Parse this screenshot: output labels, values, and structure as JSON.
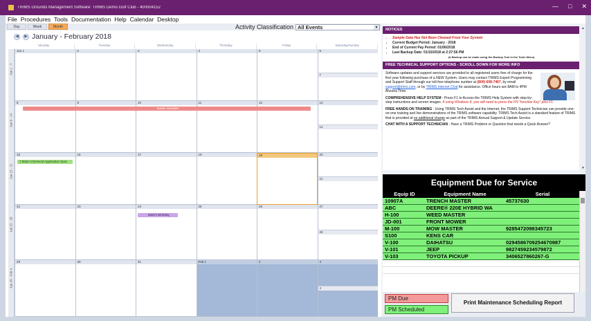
{
  "window": {
    "title": "TRIMS Grounds Management Software: TRIMS Demo Golf Club - 400004152",
    "controls": [
      "—",
      "□",
      "✕"
    ]
  },
  "menu": [
    "File",
    "Procedures",
    "Tools",
    "Documentation",
    "Help",
    "Calendar",
    "Desktop"
  ],
  "view_tabs": [
    "Day",
    "Week",
    "Month"
  ],
  "activity": {
    "label": "Activity Classification",
    "value": "All Events"
  },
  "calendar": {
    "title": "January - February 2018",
    "weekdays": [
      "Monday",
      "Tuesday",
      "Wednesday",
      "Thursday",
      "Friday",
      "Saturday/Sunday"
    ],
    "weeks": [
      {
        "label": "Jan 1 - 7",
        "days": [
          "Jan 1",
          "2",
          "3",
          "4",
          "5",
          "6"
        ],
        "sun": "7"
      },
      {
        "label": "Jan 8 - 14",
        "days": [
          "8",
          "9",
          "10",
          "11",
          "12",
          "13"
        ],
        "sun": "14"
      },
      {
        "label": "Jan 15 - 21",
        "days": [
          "15",
          "16",
          "17",
          "18",
          "19",
          "20"
        ],
        "sun": "21"
      },
      {
        "label": "Jan 22 - 28",
        "days": [
          "22",
          "23",
          "24",
          "25",
          "26",
          "27"
        ],
        "sun": "28"
      },
      {
        "label": "Jan 29 - Feb 4",
        "days": [
          "29",
          "30",
          "31",
          "Feb 1",
          "2",
          "3"
        ],
        "sun": "4"
      }
    ],
    "events": {
      "vacation": "Susan Vacation",
      "chemical": "7:00am Chemical Application Spra",
      "birthday": "Mark's Birthday"
    }
  },
  "notices": {
    "header": "NOTICES",
    "items": [
      "Sample Data Has Not Been Cleaned From Your System",
      "Current Budget Period: January - 2018",
      "End of Current Pay Period: 01/06/2018",
      "Last Backup Date: 01/15/2018 at 2:27:56 PM"
    ],
    "backup_note": "(A Backup can be made using the Backup Tool in the Tools Menu)",
    "support_header": "FREE TECHNICAL SUPPORT OPTIONS - SCROLL DOWN FOR MORE INFO",
    "support_text_1": "Software updates and support services are provided to all registered users free of charge for the first year following purchase of a NEW System. Users may contact TRIMS Expert Programming and Support Staff through our toll-free telephone number at",
    "phone": "(800) 608-7467",
    "support_text_2": ", by email",
    "email": "support@trims.com",
    "support_text_3": ", or by",
    "chat_link": "TRIMS Internet Chat",
    "support_text_4": "for assistance. Office hours are 8AM to 4PM Arizona Time.",
    "help_title": "COMPREHENSIVE HELP SYSTEM",
    "help_text": " - Press F1 to Access the TRIMS Help System with step-by-step instructions and screen images.",
    "help_note": "If using Windows 8, you will need to press the FN \"function Key\" plus F1.",
    "training_title": "FREE HANDS-ON TRAINING",
    "training_text": " - Using TRIMS Tech Assist and the Internet, the TRIMS Support Technician can provide one-on-one training and live demonstrations of the TRIMS software capability. TRIMS Tech Assist is a standard feature of TRIMS that is provided at",
    "training_link": "no additional charge",
    "training_text_2": " as part of the TRIMS Annual Support & Update Service.",
    "chat_title": "CHAT WITH A SUPPORT TECHNICIAN",
    "chat_text": " - Have a TRIMS Problem or Question that needs a Quick Answer?"
  },
  "equipment": {
    "title": "Equipment Due for Service",
    "columns": [
      "Equip ID",
      "Equipment Name",
      "Serial"
    ],
    "rows": [
      [
        "10907A",
        "TRENCH MASTER",
        "45737630"
      ],
      [
        "ABC",
        "DEERE® 220E HYBRID WA",
        ""
      ],
      [
        "H-100",
        "WEED MASTER",
        ""
      ],
      [
        "JD-001",
        "FRONT MOWER",
        ""
      ],
      [
        "M-100",
        "MOW MASTER",
        "9285472098345723"
      ],
      [
        "S100",
        "KENS CAR",
        ""
      ],
      [
        "V-100",
        "DAIHATSU",
        "0294586709254670987"
      ],
      [
        "V-101",
        "JEEP",
        "982745923457987​2"
      ],
      [
        "V-103",
        "TOYOTA PICKUP",
        "3406527860267-G"
      ]
    ]
  },
  "legend": {
    "pm_due": "PM Due",
    "pm_scheduled": "PM Scheduled"
  },
  "print_button": "Print Maintenance Scheduling Report"
}
